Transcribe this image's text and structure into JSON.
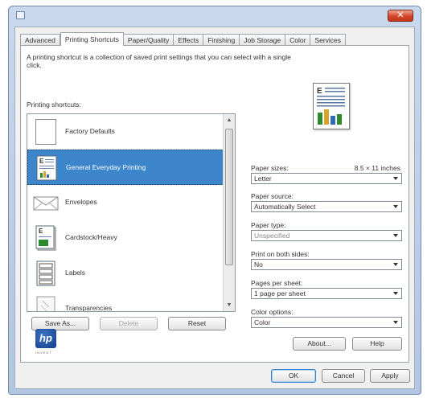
{
  "window": {
    "close_label": "✕"
  },
  "tabs": [
    "Advanced",
    "Printing Shortcuts",
    "Paper/Quality",
    "Effects",
    "Finishing",
    "Job Storage",
    "Color",
    "Services"
  ],
  "active_tab": 1,
  "shortcuts": {
    "description": "A printing shortcut is a collection of saved print settings that you can select with a single click.",
    "label": "Printing shortcuts:",
    "items": [
      {
        "label": "Factory Defaults",
        "icon": "blank-document-icon"
      },
      {
        "label": "General Everyday Printing",
        "icon": "document-chart-icon",
        "selected": true
      },
      {
        "label": "Envelopes",
        "icon": "envelope-icon"
      },
      {
        "label": "Cardstock/Heavy",
        "icon": "cardstock-icon"
      },
      {
        "label": "Labels",
        "icon": "labels-sheet-icon"
      },
      {
        "label": "Transparencies",
        "icon": "transparency-icon"
      }
    ],
    "buttons": {
      "save_as": "Save As...",
      "delete": "Delete",
      "reset": "Reset"
    }
  },
  "settings": {
    "paper_sizes": {
      "label": "Paper sizes:",
      "dimension": "8.5 × 11 inches",
      "value": "Letter"
    },
    "paper_source": {
      "label": "Paper source:",
      "value": "Automatically Select"
    },
    "paper_type": {
      "label": "Paper type:",
      "value": "Unspecified"
    },
    "print_both_sides": {
      "label": "Print on both sides:",
      "value": "No"
    },
    "pages_per_sheet": {
      "label": "Pages per sheet:",
      "value": "1 page per sheet"
    },
    "color_options": {
      "label": "Color options:",
      "value": "Color"
    }
  },
  "brand": {
    "logo_text": "hp",
    "tagline": "INVENT"
  },
  "panel_buttons": {
    "about": "About...",
    "help": "Help"
  },
  "dialog_buttons": {
    "ok": "OK",
    "cancel": "Cancel",
    "apply": "Apply"
  },
  "colors": {
    "selection": "#3d86cc",
    "title_gradient_top": "#c9d8ec",
    "close_button": "#d4462a"
  }
}
